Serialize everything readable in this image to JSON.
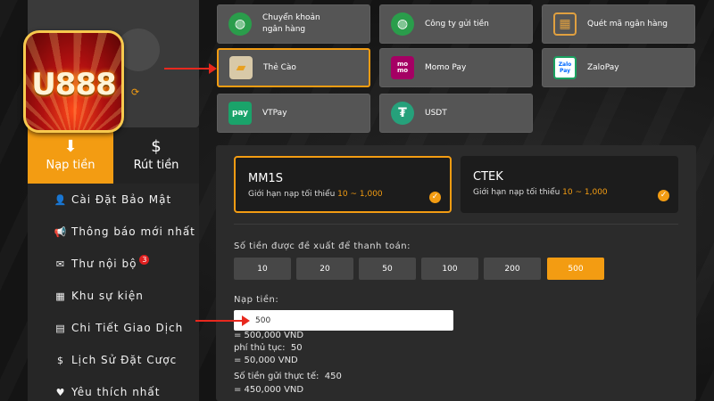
{
  "sidebar": {
    "tabs": [
      {
        "label": "Nạp tiền",
        "icon": "deposit-icon",
        "active": true
      },
      {
        "label": "Rút tiền",
        "icon": "withdraw-icon",
        "active": false
      }
    ],
    "menu": [
      {
        "label": "Cài Đặt Bảo Mật",
        "icon": "user-lock-icon"
      },
      {
        "label": "Thông báo mới nhất",
        "icon": "megaphone-icon"
      },
      {
        "label": "Thư nội bộ",
        "icon": "envelope-icon",
        "badge": "3"
      },
      {
        "label": "Khu sự kiện",
        "icon": "calendar-icon"
      },
      {
        "label": "Chi Tiết Giao Dịch",
        "icon": "clipboard-icon"
      },
      {
        "label": "Lịch Sử Đặt Cược",
        "icon": "dollar-circle-icon"
      },
      {
        "label": "Yêu thích nhất",
        "icon": "heart-icon"
      }
    ]
  },
  "logo": {
    "text": "U888"
  },
  "payment_methods": [
    {
      "label": "Chuyển khoản ngân hàng",
      "icon": "globe-icon"
    },
    {
      "label": "Công ty gửi tiền",
      "icon": "globe-icon"
    },
    {
      "label": "Quét mã ngân hàng",
      "icon": "qr-code-icon"
    },
    {
      "label": "Thẻ Cào",
      "icon": "scratch-card-icon",
      "selected": true
    },
    {
      "label": "Momo Pay",
      "icon": "momo-icon",
      "icon_text": "mo mo"
    },
    {
      "label": "ZaloPay",
      "icon": "zalopay-icon",
      "icon_text": "Zalo Pay"
    },
    {
      "label": "VTPay",
      "icon": "vtpay-icon",
      "icon_text": "pay"
    },
    {
      "label": "USDT",
      "icon": "tether-icon",
      "icon_text": "₮"
    }
  ],
  "channels": [
    {
      "name": "MM1S",
      "limit_prefix": "Giới hạn nạp tối thiểu",
      "min": "10",
      "sep": " ~ ",
      "max": "1,000",
      "selected": true
    },
    {
      "name": "CTEK",
      "limit_prefix": "Giới hạn nạp tối thiểu",
      "min": "10",
      "sep": " ~ ",
      "max": "1,000",
      "selected": false
    }
  ],
  "suggested_label": "Số tiền được đề xuất để thanh toán:",
  "amounts": [
    "10",
    "20",
    "50",
    "100",
    "200",
    "500"
  ],
  "selected_amount": "500",
  "deposit_label": "Nạp tiền:",
  "deposit_value": "500",
  "summary": {
    "converted": "= 500,000 VND",
    "fee_label": "phí thủ tục:",
    "fee_value": "50",
    "fee_converted": "= 50,000 VND",
    "actual_label": "Số tiền gửi thực tế:",
    "actual_value": "450",
    "actual_converted": "= 450,000 VND"
  },
  "colors": {
    "accent": "#f39c12",
    "arrow": "#e8281e"
  }
}
